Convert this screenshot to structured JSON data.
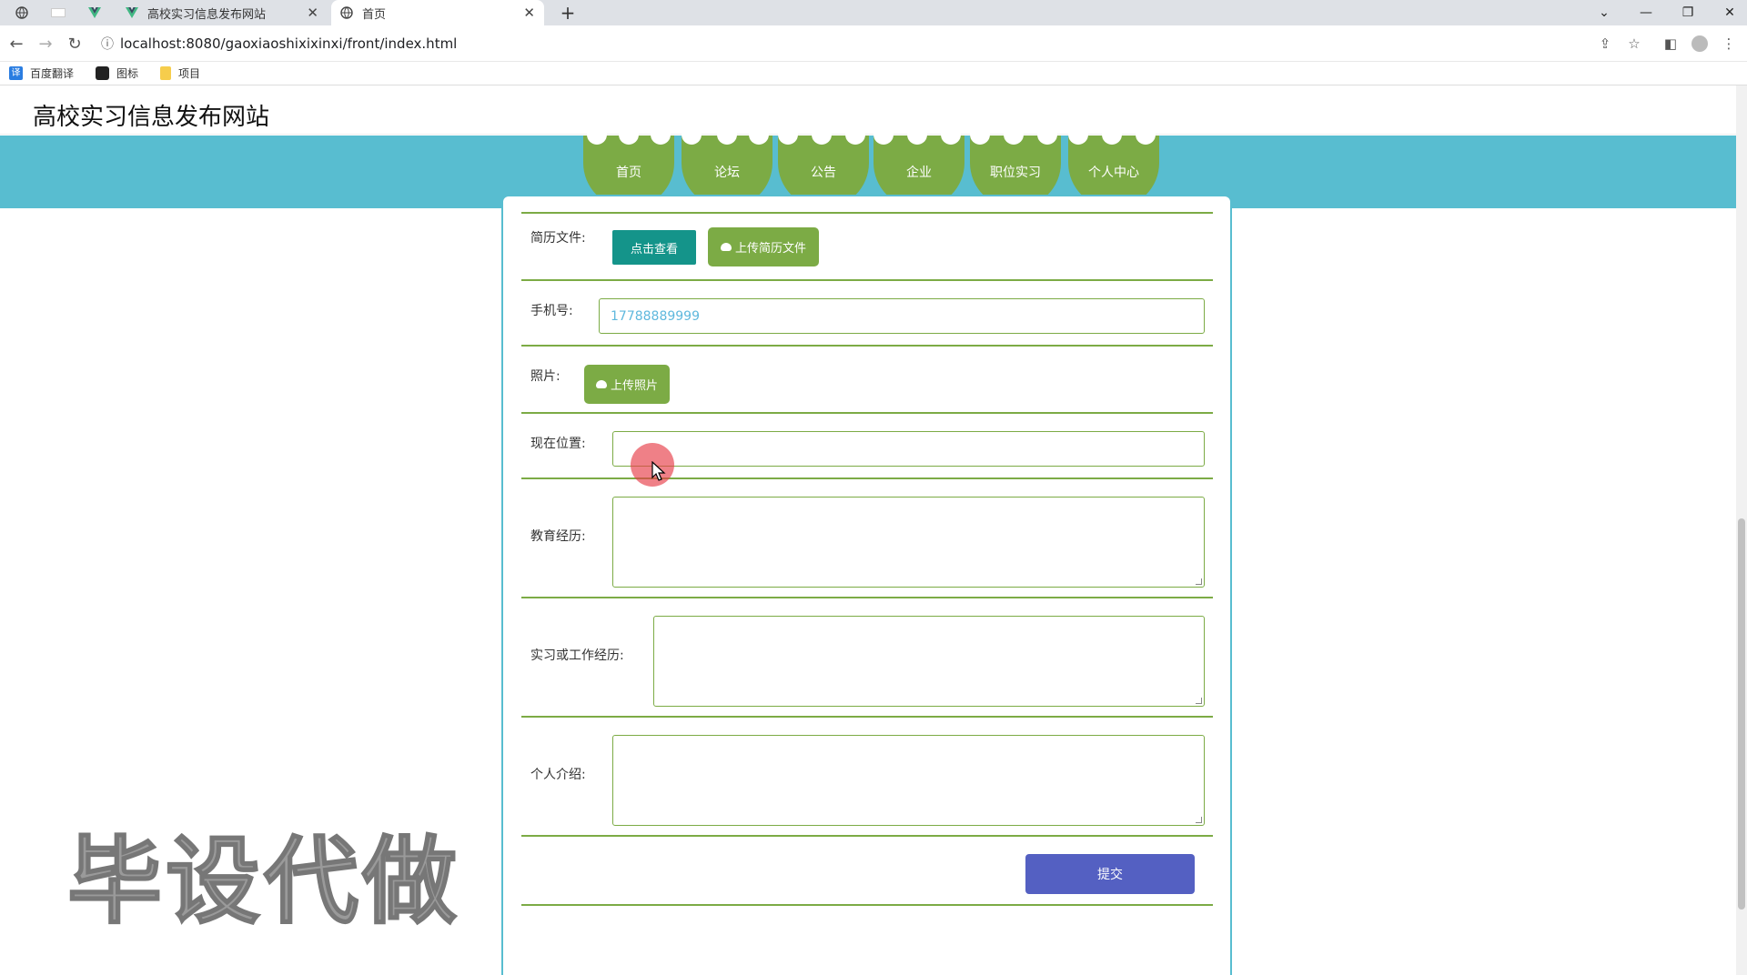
{
  "browser": {
    "tabs": [
      {
        "title": "高校实习信息发布网站"
      },
      {
        "title": "首页"
      }
    ],
    "new_tab": "+",
    "url": "localhost:8080/gaoxiaoshixixinxi/front/index.html",
    "bookmarks": [
      {
        "label": "百度翻译",
        "icon": "translate-icon"
      },
      {
        "label": "图标",
        "icon": "image-icon"
      },
      {
        "label": "项目",
        "icon": "folder-icon"
      }
    ]
  },
  "site": {
    "title": "高校实习信息发布网站",
    "nav": [
      {
        "label": "首页"
      },
      {
        "label": "论坛"
      },
      {
        "label": "公告"
      },
      {
        "label": "企业"
      },
      {
        "label": "职位实习"
      },
      {
        "label": "个人中心"
      }
    ]
  },
  "form": {
    "resume_label": "简历文件:",
    "view_button": "点击查看",
    "upload_resume_button": "上传简历文件",
    "phone_label": "手机号:",
    "phone_value": "17788889999",
    "photo_label": "照片:",
    "upload_photo_button": "上传照片",
    "location_label": "现在位置:",
    "location_value": "",
    "education_label": "教育经历:",
    "work_label": "实习或工作经历:",
    "intro_label": "个人介绍:",
    "submit_button": "提交"
  },
  "watermark": "毕设代做",
  "colors": {
    "nav_band": "#58bdd0",
    "nav_item": "#7cab45",
    "view_button": "#14948a",
    "upload_button": "#7cab45",
    "submit_button": "#5460c2"
  }
}
